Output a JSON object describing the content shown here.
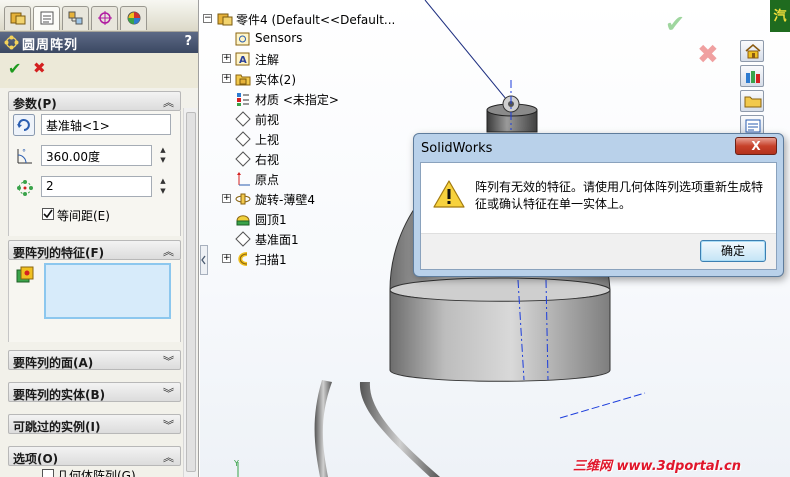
{
  "property_manager": {
    "title": "圆周阵列",
    "help": "?",
    "ok_glyph": "✔",
    "cancel_glyph": "✖",
    "groups": {
      "params": {
        "label": "参数(P)",
        "axis_value": "基准轴<1>",
        "angle_value": "360.00度",
        "count_value": "2",
        "equal_spacing_label": "等间距(E)",
        "equal_spacing_checked": true
      },
      "features": {
        "label": "要阵列的特征(F)"
      },
      "faces": {
        "label": "要阵列的面(A)"
      },
      "bodies": {
        "label": "要阵列的实体(B)"
      },
      "skip": {
        "label": "可跳过的实例(I)"
      },
      "options": {
        "label": "选项(O)",
        "geometry_pattern_label": "几何体阵列(G)"
      }
    }
  },
  "feature_tree": {
    "root": "零件4  (Default<<Default...",
    "items": [
      {
        "label": "Sensors",
        "expandable": false,
        "icon": "sensor-icon"
      },
      {
        "label": "注解",
        "expandable": true,
        "icon": "annotation-icon"
      },
      {
        "label": "实体(2)",
        "expandable": true,
        "icon": "solid-bodies-icon"
      },
      {
        "label": "材质 <未指定>",
        "expandable": false,
        "icon": "material-icon"
      },
      {
        "label": "前视",
        "expandable": false,
        "icon": "plane-icon"
      },
      {
        "label": "上视",
        "expandable": false,
        "icon": "plane-icon"
      },
      {
        "label": "右视",
        "expandable": false,
        "icon": "plane-icon"
      },
      {
        "label": "原点",
        "expandable": false,
        "icon": "origin-icon"
      },
      {
        "label": "旋转-薄壁4",
        "expandable": true,
        "icon": "revolve-icon"
      },
      {
        "label": "圆顶1",
        "expandable": false,
        "icon": "dome-icon"
      },
      {
        "label": "基准面1",
        "expandable": false,
        "icon": "plane-icon"
      },
      {
        "label": "扫描1",
        "expandable": true,
        "icon": "sweep-icon"
      }
    ]
  },
  "top_right_label": "汽",
  "dialog": {
    "title": "SolidWorks",
    "close": "X",
    "message": "阵列有无效的特征。请使用几何体阵列选项重新生成特征或确认特征在单一实体上。",
    "ok_label": "确定"
  },
  "watermark": "三维网 www.3dportal.cn",
  "colors": {
    "header_bg": "#3b4862",
    "accent_green": "#1e9a1e",
    "accent_red": "#d42020",
    "dialog_frame": "#b9d1ea",
    "watermark": "#e0162b"
  }
}
